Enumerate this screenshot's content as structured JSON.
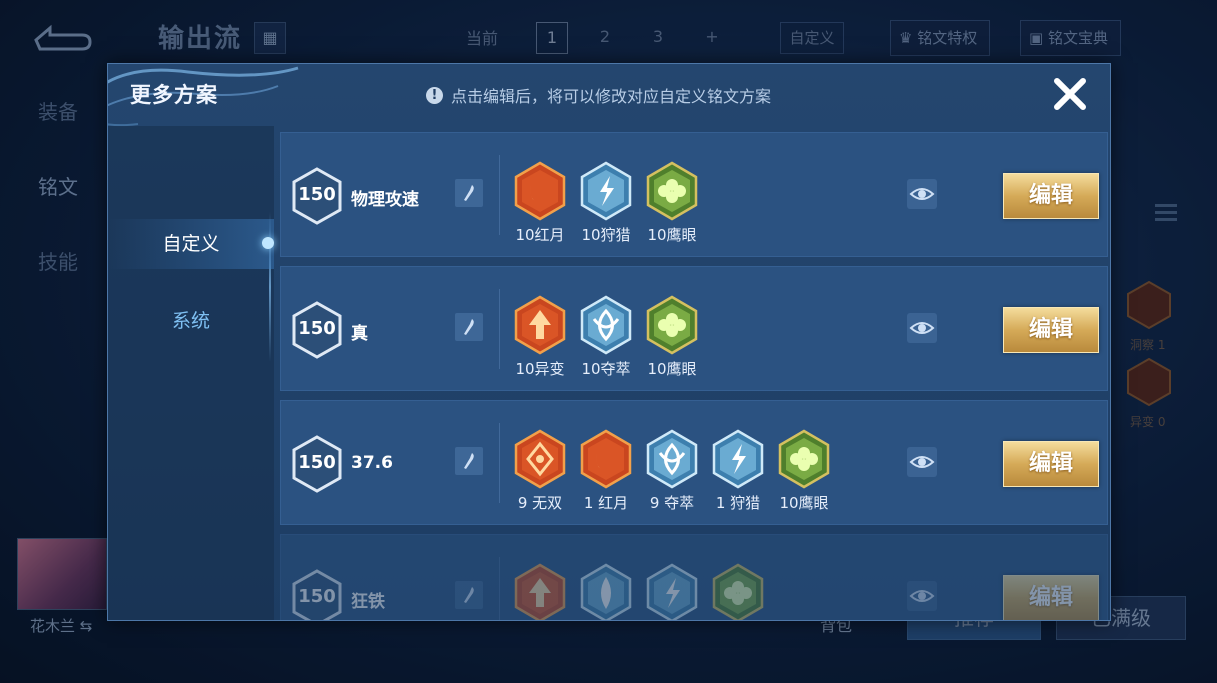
{
  "background": {
    "title": "输出流",
    "current_label": "当前",
    "pages": [
      "1",
      "2",
      "3",
      "+"
    ],
    "custom_label": "自定义",
    "privilege_label": "铭文特权",
    "codex_label": "铭文宝典",
    "side_tabs": [
      "装备",
      "铭文",
      "技能"
    ],
    "hero_name": "花木兰",
    "bag_label": "背包",
    "recommend_label": "推荐",
    "max_level_label": "已满级",
    "right_runes": [
      "洞察 1",
      "异变 0"
    ]
  },
  "modal": {
    "title": "更多方案",
    "hint": "点击编辑后，将可以修改对应自定义铭文方案",
    "hint_icon": "!",
    "nav": [
      "自定义",
      "系统"
    ],
    "edit_label": "编辑",
    "rows": [
      {
        "level": "150",
        "name": "物理攻速",
        "runes": [
          {
            "label": "10红月",
            "color": "red",
            "glyph": "moon"
          },
          {
            "label": "10狩猎",
            "color": "blue",
            "glyph": "bolt"
          },
          {
            "label": "10鹰眼",
            "color": "green",
            "glyph": "clover"
          }
        ]
      },
      {
        "level": "150",
        "name": "真",
        "runes": [
          {
            "label": "10异变",
            "color": "red",
            "glyph": "arrow"
          },
          {
            "label": "10夺萃",
            "color": "blue",
            "glyph": "knot"
          },
          {
            "label": "10鹰眼",
            "color": "green",
            "glyph": "clover"
          }
        ]
      },
      {
        "level": "150",
        "name": "37.6",
        "runes": [
          {
            "label": "9 无双",
            "color": "red",
            "glyph": "diamond"
          },
          {
            "label": "1 红月",
            "color": "red",
            "glyph": "moon"
          },
          {
            "label": "9 夺萃",
            "color": "blue",
            "glyph": "knot"
          },
          {
            "label": "1 狩猎",
            "color": "blue",
            "glyph": "bolt"
          },
          {
            "label": "10鹰眼",
            "color": "green",
            "glyph": "clover"
          }
        ]
      },
      {
        "level": "150",
        "name": "狂铁",
        "runes": [
          {
            "label": "",
            "color": "red",
            "glyph": "arrow"
          },
          {
            "label": "",
            "color": "blue",
            "glyph": "leaf"
          },
          {
            "label": "",
            "color": "blue",
            "glyph": "bolt"
          },
          {
            "label": "",
            "color": "green",
            "glyph": "clover"
          }
        ]
      }
    ]
  },
  "colors": {
    "rune_red": "#d8532a",
    "rune_blue": "#7fc3e8",
    "rune_green": "#8cc152",
    "gold_button": "#d5aa58",
    "panel": "#2b5281"
  }
}
